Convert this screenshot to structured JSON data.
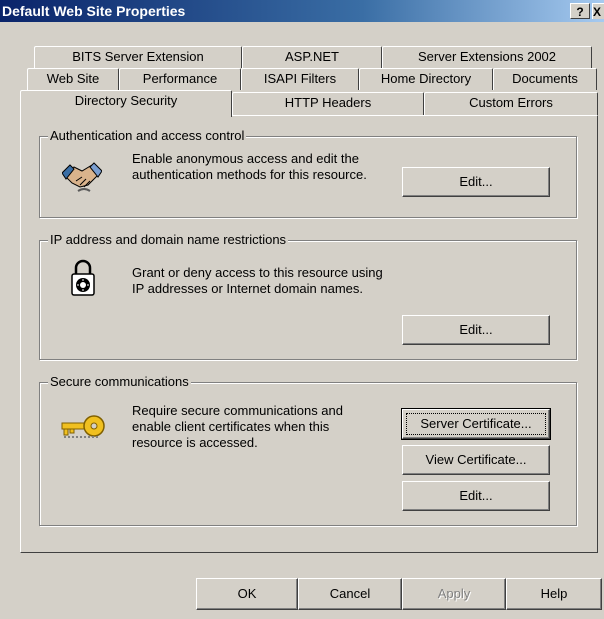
{
  "window": {
    "title": "Default Web Site Properties",
    "help_glyph": "?",
    "close_glyph": "X"
  },
  "tabs": {
    "row1": [
      "BITS Server Extension",
      "ASP.NET",
      "Server Extensions 2002"
    ],
    "row2": [
      "Web Site",
      "Performance",
      "ISAPI Filters",
      "Home Directory",
      "Documents"
    ],
    "row3": [
      "Directory Security",
      "HTTP Headers",
      "Custom Errors"
    ],
    "active": "Directory Security"
  },
  "auth_group": {
    "legend": "Authentication and access control",
    "description": "Enable anonymous access and edit the\nauthentication methods for this resource.",
    "edit_button": "Edit...",
    "icon": "handshake-icon"
  },
  "ip_group": {
    "legend": "IP address and domain name restrictions",
    "description": "Grant or deny access to this resource using\nIP addresses or Internet domain names.",
    "edit_button": "Edit...",
    "icon": "padlock-icon"
  },
  "secure_group": {
    "legend": "Secure communications",
    "description": "Require secure communications and\nenable client certificates when this\nresource is accessed.",
    "server_cert_button": "Server Certificate...",
    "view_cert_button": "View Certificate...",
    "edit_button": "Edit...",
    "icon": "key-icon"
  },
  "footer": {
    "ok": "OK",
    "cancel": "Cancel",
    "apply": "Apply",
    "help": "Help"
  }
}
